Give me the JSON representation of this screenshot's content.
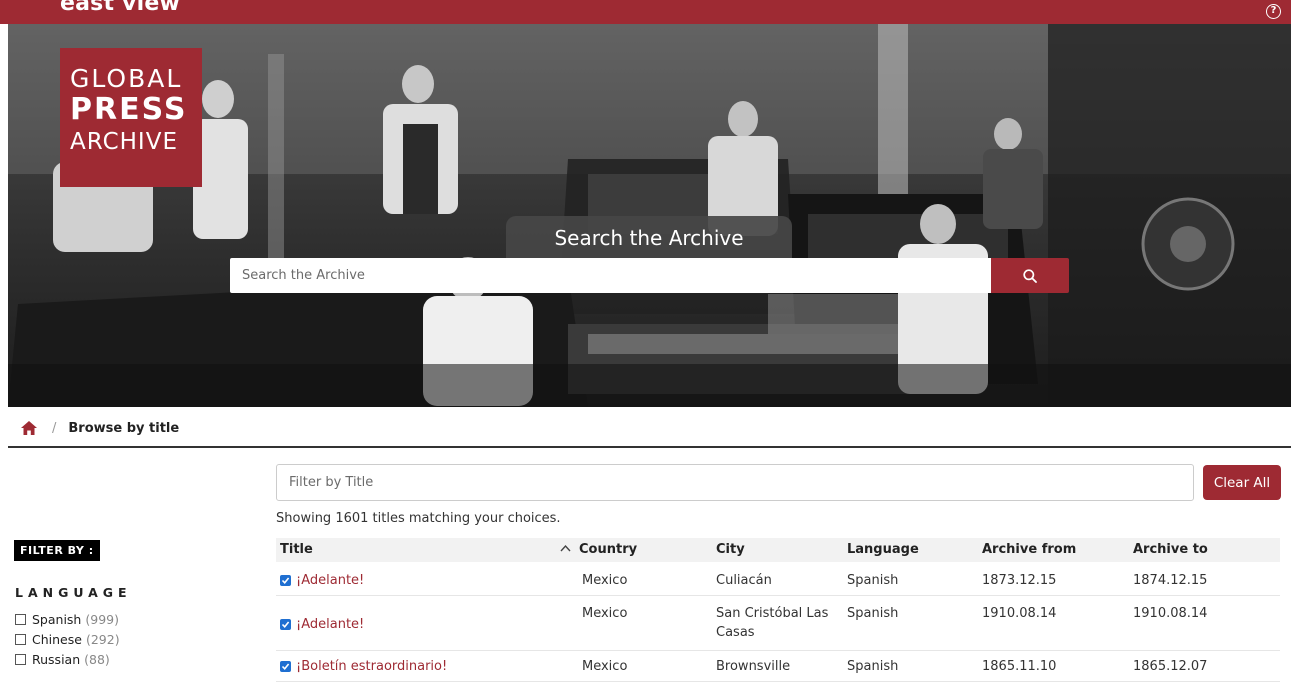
{
  "topbar": {
    "brand": "east view",
    "help_glyph": "?"
  },
  "logo": {
    "line1": "GLOBAL",
    "line2": "PRESS",
    "line3": "ARCHIVE"
  },
  "hero_search": {
    "title": "Search the Archive",
    "placeholder": "Search the Archive",
    "icon": "search-icon"
  },
  "breadcrumb": {
    "home_icon": "home-icon",
    "separator": "/",
    "current": "Browse by title"
  },
  "sidebar": {
    "filter_by": "FILTER BY :",
    "facet_heading": "LANGUAGE",
    "languages": [
      {
        "label": "Spanish",
        "count": "(999)"
      },
      {
        "label": "Chinese",
        "count": "(292)"
      },
      {
        "label": "Russian",
        "count": "(88)"
      }
    ]
  },
  "main": {
    "filter_placeholder": "Filter by Title",
    "clear_label": "Clear All",
    "result_text": "Showing 1601 titles matching your choices.",
    "columns": [
      "Title",
      "Country",
      "City",
      "Language",
      "Archive from",
      "Archive to"
    ],
    "sort_glyph": "^",
    "rows": [
      {
        "title": "¡Adelante!",
        "country": "Mexico",
        "city": "Culiacán",
        "language": "Spanish",
        "from": "1873.12.15",
        "to": "1874.12.15"
      },
      {
        "title": "¡Adelante!",
        "country": "Mexico",
        "city": "San Cristóbal Las Casas",
        "language": "Spanish",
        "from": "1910.08.14",
        "to": "1910.08.14"
      },
      {
        "title": "¡Boletín estraordinario!",
        "country": "Mexico",
        "city": "Brownsville",
        "language": "Spanish",
        "from": "1865.11.10",
        "to": "1865.12.07"
      }
    ]
  },
  "colors": {
    "brand": "#9e2a33",
    "checkbox": "#1f6fd1"
  }
}
